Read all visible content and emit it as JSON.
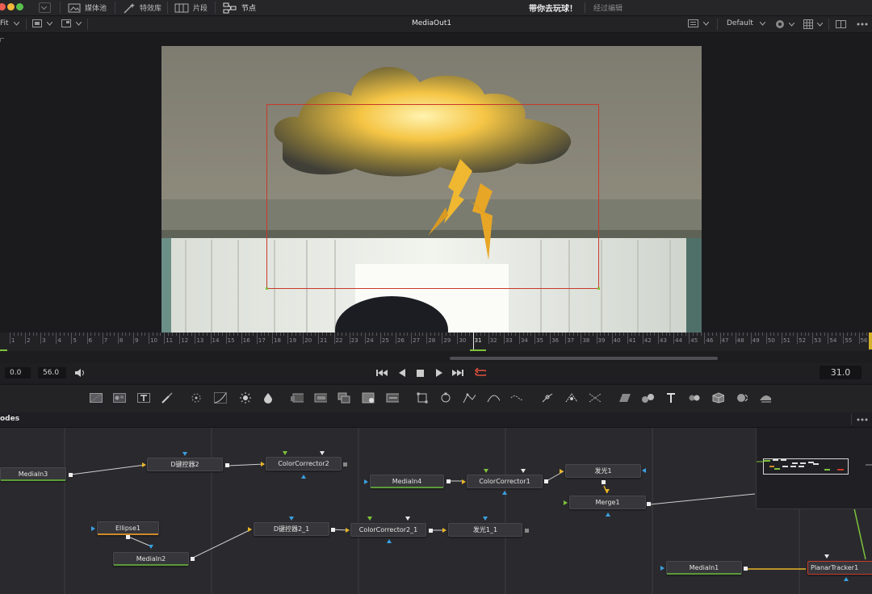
{
  "topbar": {
    "tabs": [
      {
        "label": "媒体池",
        "icon": "media-pool-icon"
      },
      {
        "label": "特效库",
        "icon": "effects-library-icon"
      },
      {
        "label": "片段",
        "icon": "clips-icon"
      },
      {
        "label": "节点",
        "icon": "nodes-icon"
      }
    ],
    "project_title": "带你去玩球！",
    "edit_status": "经过编辑"
  },
  "viewer": {
    "zoom": "Fit",
    "name": "MediaOut1",
    "preset": "Default"
  },
  "timeline": {
    "ticks": [
      "1",
      "2",
      "3",
      "4",
      "5",
      "6",
      "7",
      "8",
      "9",
      "10",
      "11",
      "12",
      "13",
      "14",
      "15",
      "16",
      "17",
      "18",
      "19",
      "20",
      "21",
      "22",
      "23",
      "24",
      "25",
      "26",
      "27",
      "28",
      "29",
      "30",
      "31",
      "32",
      "33",
      "34",
      "35",
      "36",
      "37",
      "38",
      "39",
      "40",
      "41",
      "42",
      "43",
      "44",
      "45",
      "46",
      "47",
      "48",
      "49",
      "50",
      "51",
      "52",
      "53",
      "54",
      "55",
      "56"
    ],
    "playhead": 31
  },
  "transport": {
    "start": "0.0",
    "end": "56.0",
    "current": "31.0"
  },
  "nodes_panel": {
    "title": "odes",
    "nodes": {
      "mediain3": "MediaIn3",
      "dkey2": "D键控器2",
      "cc2": "ColorCorrector2",
      "mediain4": "MediaIn4",
      "cc1": "ColorCorrector1",
      "glow1": "发光1",
      "merge1": "Merge1",
      "ellipse1": "Ellipse1",
      "mediain2": "MediaIn2",
      "dkey2_1": "D键控器2_1",
      "cc2_1": "ColorCorrector2_1",
      "glow1_1": "发光1_1",
      "mediain1": "MediaIn1",
      "tracker1": "PlanarTracker1"
    }
  },
  "colors": {
    "accent": "#f2a830",
    "tracker_border": "#c8392b",
    "green_link": "#7ec23a",
    "yellow_link": "#e8b526"
  }
}
